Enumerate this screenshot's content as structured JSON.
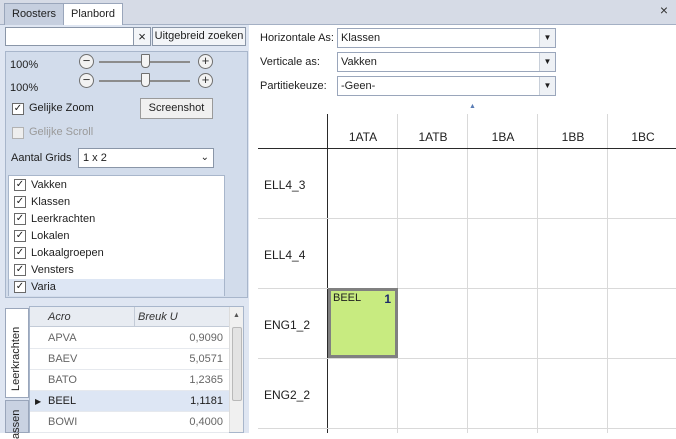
{
  "tabs": [
    "Roosters",
    "Planbord"
  ],
  "close_glyph": "×",
  "search": {
    "value": "",
    "clear_glyph": "×",
    "advanced_label": "Uitgebreid zoeken"
  },
  "zoom": {
    "h_percent_label": "100%",
    "v_percent_label": "100%",
    "h_value": 1.0,
    "v_value": 1.0
  },
  "options": {
    "same_zoom_label": "Gelijke Zoom",
    "same_zoom_checked": true,
    "same_scroll_label": "Gelijke Scroll",
    "same_scroll_checked": false,
    "screenshot_label": "Screenshot",
    "grids_label": "Aantal Grids",
    "grids_value": "1 x 2"
  },
  "layers": [
    {
      "label": "Vakken",
      "checked": true
    },
    {
      "label": "Klassen",
      "checked": true
    },
    {
      "label": "Leerkrachten",
      "checked": true
    },
    {
      "label": "Lokalen",
      "checked": true
    },
    {
      "label": "Lokaalgroepen",
      "checked": true
    },
    {
      "label": "Vensters",
      "checked": true
    },
    {
      "label": "Varia",
      "checked": true
    }
  ],
  "side_tabs": [
    "Leerkrachten",
    "assen"
  ],
  "table": {
    "headers": [
      "Acro",
      "Breuk U"
    ],
    "rows": [
      {
        "acro": "APVA",
        "breuk": "0,9090"
      },
      {
        "acro": "BAEV",
        "breuk": "5,0571"
      },
      {
        "acro": "BATO",
        "breuk": "1,2365"
      },
      {
        "acro": "BEEL",
        "breuk": "1,1181",
        "selected": true
      },
      {
        "acro": "BOWI",
        "breuk": "0,4000"
      }
    ]
  },
  "axes": {
    "horizontal_label": "Horizontale As:",
    "horizontal_value": "Klassen",
    "vertical_label": "Verticale as:",
    "vertical_value": "Vakken",
    "partition_label": "Partitiekeuze:",
    "partition_value": "-Geen-"
  },
  "grid": {
    "columns": [
      "1ATA",
      "1ATB",
      "1BA",
      "1BB",
      "1BC"
    ],
    "rows": [
      "ELL4_3",
      "ELL4_4",
      "ENG1_2",
      "ENG2_2"
    ],
    "cell": {
      "text": "BEEL",
      "count": "1"
    }
  },
  "colors": {
    "cell_fill": "#c8eb80",
    "panel_bg": "#dfe6f2",
    "selection": "#dde6f4"
  }
}
